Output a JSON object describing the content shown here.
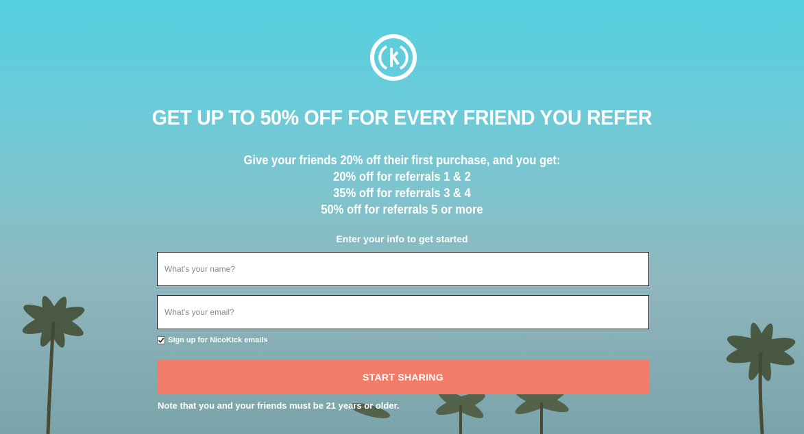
{
  "brand": {
    "logo_icon": "nicokick-logo-icon"
  },
  "headline": "GET UP TO 50% OFF FOR EVERY FRIEND YOU REFER",
  "benefits": {
    "intro": "Give your friends 20% off their first purchase, and you get:",
    "tiers": [
      "20% off for referrals 1 & 2",
      "35% off for referrals 3 & 4",
      "50% off for referrals 5 or more"
    ]
  },
  "form": {
    "prompt": "Enter your info to get started",
    "name_placeholder": "What's your name?",
    "email_placeholder": "What's your email?",
    "optin_label": "Sign up for NicoKick emails",
    "optin_checked": true,
    "submit_label": "START SHARING"
  },
  "note": "Note that you and your friends must be 21 years or older.",
  "colors": {
    "accent": "#f37c69",
    "text": "#ffffff",
    "sky_top": "#53cfdf"
  }
}
